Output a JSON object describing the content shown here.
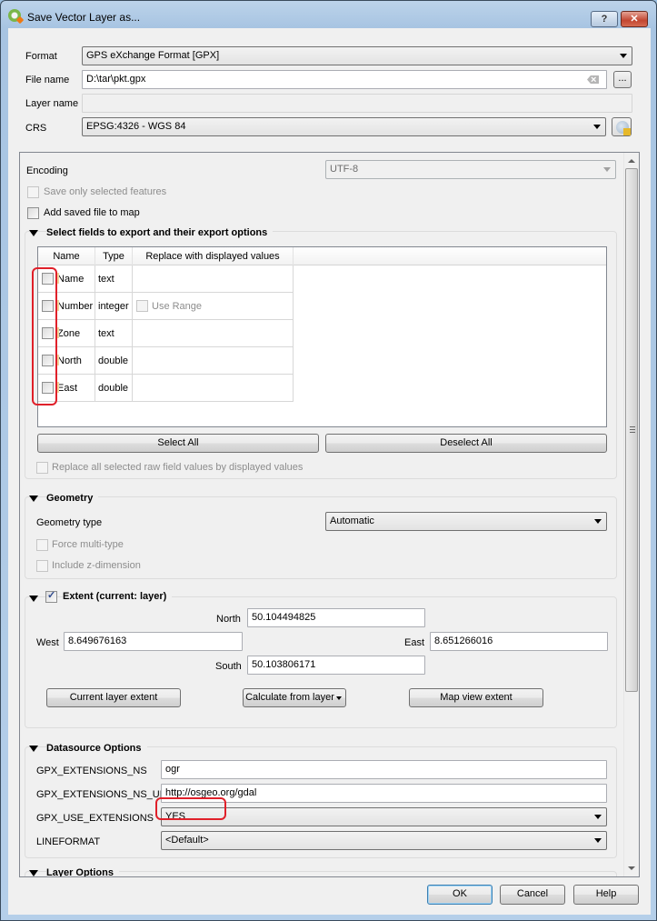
{
  "window": {
    "title": "Save Vector Layer as...",
    "help_button": "?",
    "close_button": "✕"
  },
  "form": {
    "format_label": "Format",
    "format_value": "GPS eXchange Format [GPX]",
    "file_name_label": "File name",
    "file_name_value": "D:\\tar\\pkt.gpx",
    "browse_button": "...",
    "layer_name_label": "Layer name",
    "layer_name_value": "",
    "crs_label": "CRS",
    "crs_value": "EPSG:4326 - WGS 84"
  },
  "options": {
    "encoding_label": "Encoding",
    "encoding_value": "UTF-8",
    "save_only_selected": {
      "label": "Save only selected features",
      "checked": false,
      "enabled": false
    },
    "add_to_map": {
      "label": "Add saved file to map",
      "checked": false,
      "enabled": true
    }
  },
  "fields_group": {
    "title": "Select fields to export and their export options",
    "columns": [
      "Name",
      "Type",
      "Replace with displayed values"
    ],
    "rows": [
      {
        "name": "Name",
        "type": "text",
        "replace": "",
        "checked": false
      },
      {
        "name": "Number",
        "type": "integer",
        "replace": "Use Range",
        "checked": false
      },
      {
        "name": "Zone",
        "type": "text",
        "replace": "",
        "checked": false
      },
      {
        "name": "North",
        "type": "double",
        "replace": "",
        "checked": false
      },
      {
        "name": "East",
        "type": "double",
        "replace": "",
        "checked": false
      }
    ],
    "select_all": "Select All",
    "deselect_all": "Deselect All",
    "replace_all_label": "Replace all selected raw field values by displayed values"
  },
  "geometry_group": {
    "title": "Geometry",
    "type_label": "Geometry type",
    "type_value": "Automatic",
    "force_multi_label": "Force multi-type",
    "include_z_label": "Include z-dimension"
  },
  "extent_group": {
    "title": "Extent (current: layer)",
    "checked": true,
    "north_label": "North",
    "north_value": "50.104494825",
    "west_label": "West",
    "west_value": "8.649676163",
    "east_label": "East",
    "east_value": "8.651266016",
    "south_label": "South",
    "south_value": "50.103806171",
    "current_layer_extent": "Current layer extent",
    "calculate_from_layer": "Calculate from layer",
    "map_view_extent": "Map view extent"
  },
  "datasource_group": {
    "title": "Datasource Options",
    "options": [
      {
        "label": "GPX_EXTENSIONS_NS",
        "value": "ogr",
        "kind": "text"
      },
      {
        "label": "GPX_EXTENSIONS_NS_URL",
        "value": "http://osgeo.org/gdal",
        "kind": "text"
      },
      {
        "label": "GPX_USE_EXTENSIONS",
        "value": "YES",
        "kind": "combo"
      },
      {
        "label": "LINEFORMAT",
        "value": "<Default>",
        "kind": "combo"
      }
    ]
  },
  "layer_options_group": {
    "title": "Layer Options"
  },
  "footer": {
    "ok": "OK",
    "cancel": "Cancel",
    "help": "Help"
  },
  "annotations": {
    "highlight_color": "#e0202a"
  }
}
